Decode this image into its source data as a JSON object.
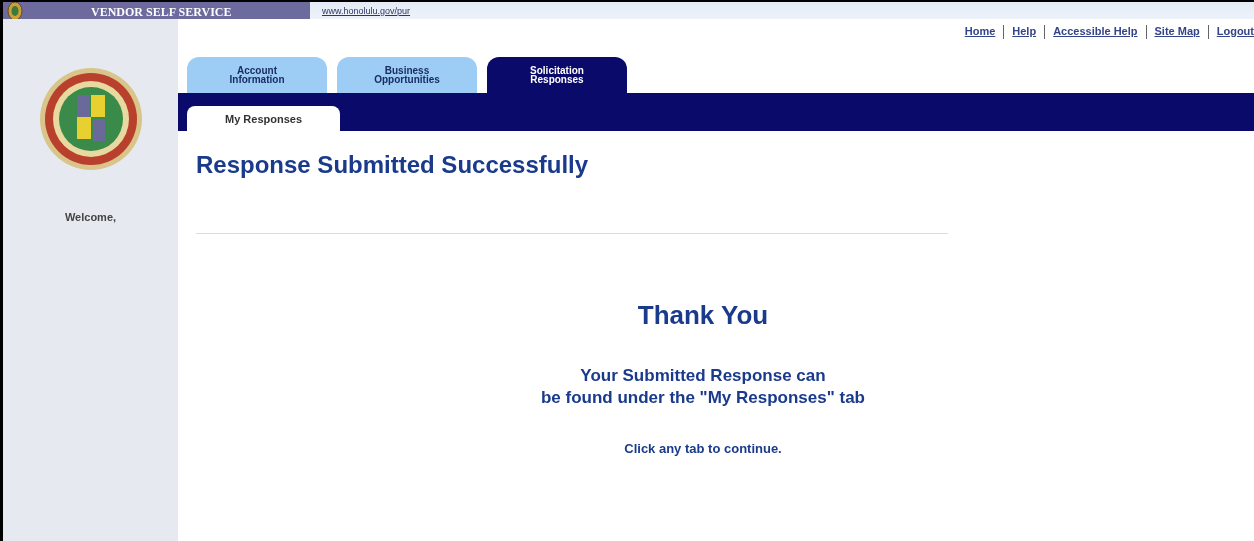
{
  "header": {
    "title": "VENDOR SELF SERVICE",
    "link": "www.honolulu.gov/pur"
  },
  "top_links": [
    "Home",
    "Help",
    "Accessible Help",
    "Site Map",
    "Logout"
  ],
  "sidebar": {
    "welcome": "Welcome,"
  },
  "tabs": [
    {
      "label": "Account Information",
      "selected": false
    },
    {
      "label": "Business Opportunities",
      "selected": false
    },
    {
      "label": "Solicitation Responses",
      "selected": true
    }
  ],
  "subtabs": [
    {
      "label": "My Responses",
      "selected": true
    }
  ],
  "heading": "Response Submitted Successfully",
  "thank_you": "Thank You",
  "message_lines": [
    "Your Submitted Response can",
    "be found under the \"My Responses\" tab"
  ],
  "continue_note": "Click any tab to continue."
}
